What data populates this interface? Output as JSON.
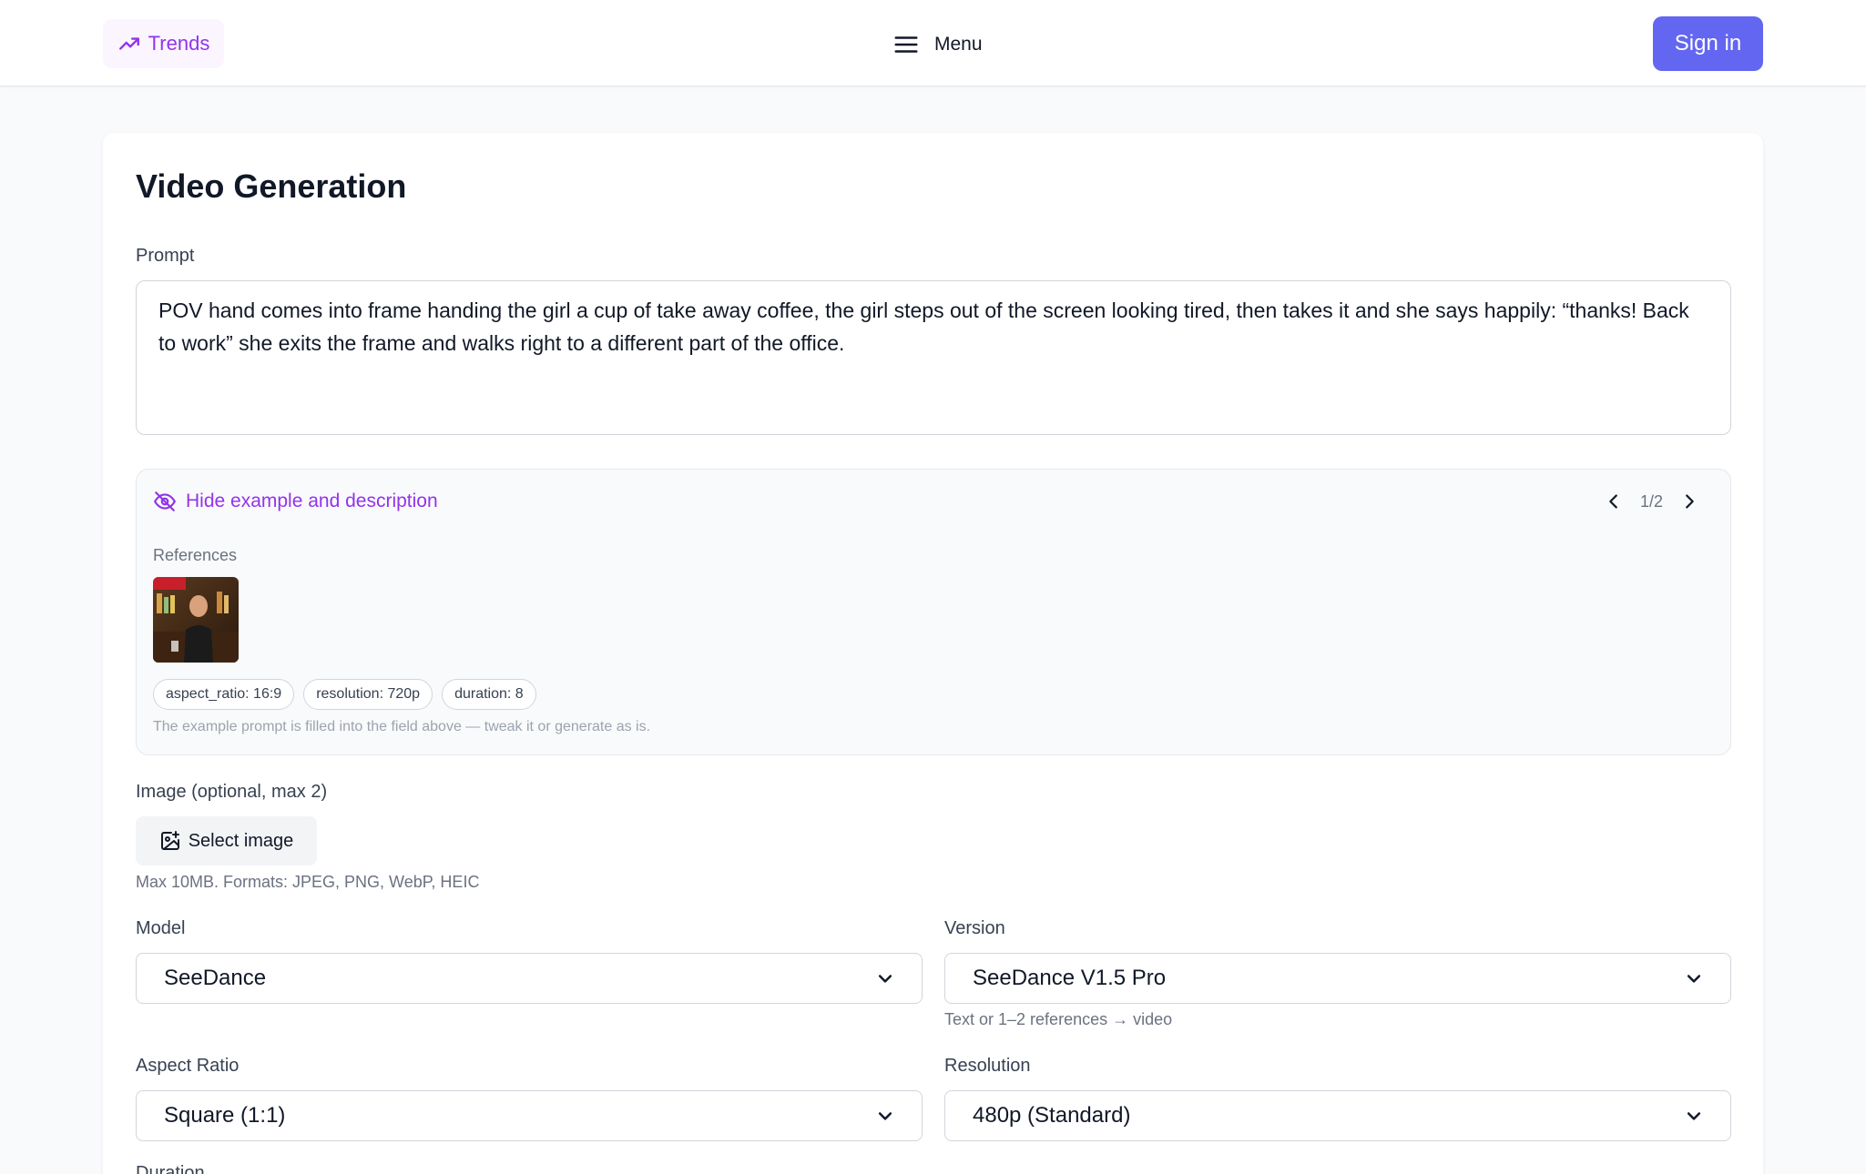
{
  "header": {
    "trends_label": "Trends",
    "menu_label": "Menu",
    "signin_label": "Sign in"
  },
  "page": {
    "title": "Video Generation"
  },
  "prompt": {
    "label": "Prompt",
    "value": "POV hand comes into frame handing the girl a cup of take away coffee, the girl steps out of the screen looking tired, then takes it and she says happily: “thanks! Back to work” she exits the frame and walks right to a different part of the office."
  },
  "example": {
    "toggle_label": "Hide example and description",
    "pager_text": "1/2",
    "references_label": "References",
    "chips": [
      "aspect_ratio: 16:9",
      "resolution: 720p",
      "duration: 8"
    ],
    "hint": "The example prompt is filled into the field above — tweak it or generate as is."
  },
  "image_upload": {
    "label": "Image (optional, max 2)",
    "button_label": "Select image",
    "hint": "Max 10MB. Formats: JPEG, PNG, WebP, HEIC"
  },
  "model": {
    "label": "Model",
    "value": "SeeDance"
  },
  "version": {
    "label": "Version",
    "value": "SeeDance V1.5 Pro",
    "hint": "Text or 1–2 references → video"
  },
  "aspect_ratio": {
    "label": "Aspect Ratio",
    "value": "Square (1:1)"
  },
  "resolution": {
    "label": "Resolution",
    "value": "480p (Standard)"
  },
  "duration": {
    "label": "Duration"
  },
  "colors": {
    "accent_purple": "#9333ea",
    "primary_indigo": "#6366f1"
  }
}
